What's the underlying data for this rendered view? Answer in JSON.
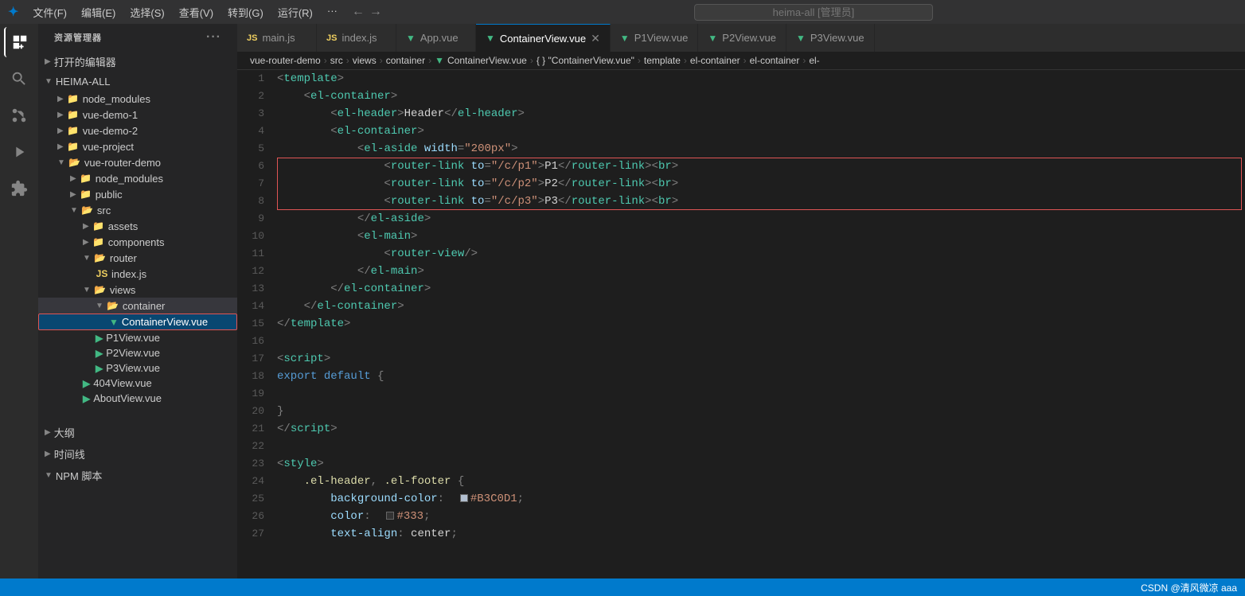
{
  "titlebar": {
    "logo": "VS",
    "menus": [
      "文件(F)",
      "编辑(E)",
      "选择(S)",
      "查看(V)",
      "转到(G)",
      "运行(R)",
      "···"
    ],
    "search_placeholder": "heima-all [管理员]",
    "back_arrow": "←",
    "forward_arrow": "→"
  },
  "sidebar": {
    "header": "资源管理器",
    "dots": "···",
    "open_editors_label": "打开的编辑器",
    "root": "HEIMA-ALL",
    "items": [
      {
        "label": "node_modules",
        "indent": 1,
        "type": "folder",
        "collapsed": true
      },
      {
        "label": "vue-demo-1",
        "indent": 1,
        "type": "folder",
        "collapsed": true
      },
      {
        "label": "vue-demo-2",
        "indent": 1,
        "type": "folder",
        "collapsed": true
      },
      {
        "label": "vue-project",
        "indent": 1,
        "type": "folder",
        "collapsed": true
      },
      {
        "label": "vue-router-demo",
        "indent": 1,
        "type": "folder",
        "collapsed": false
      },
      {
        "label": "node_modules",
        "indent": 2,
        "type": "folder",
        "collapsed": true
      },
      {
        "label": "public",
        "indent": 2,
        "type": "folder",
        "collapsed": true
      },
      {
        "label": "src",
        "indent": 2,
        "type": "folder",
        "collapsed": false
      },
      {
        "label": "assets",
        "indent": 3,
        "type": "folder-img",
        "collapsed": true
      },
      {
        "label": "components",
        "indent": 3,
        "type": "folder-img",
        "collapsed": true
      },
      {
        "label": "router",
        "indent": 3,
        "type": "folder",
        "collapsed": false
      },
      {
        "label": "index.js",
        "indent": 4,
        "type": "js"
      },
      {
        "label": "views",
        "indent": 3,
        "type": "folder",
        "collapsed": false
      },
      {
        "label": "container",
        "indent": 4,
        "type": "folder",
        "collapsed": false,
        "selected": true
      },
      {
        "label": "ContainerView.vue",
        "indent": 5,
        "type": "vue",
        "active": true
      },
      {
        "label": "P1View.vue",
        "indent": 4,
        "type": "vue"
      },
      {
        "label": "P2View.vue",
        "indent": 4,
        "type": "vue"
      },
      {
        "label": "P3View.vue",
        "indent": 4,
        "type": "vue"
      },
      {
        "label": "404View.vue",
        "indent": 3,
        "type": "vue"
      },
      {
        "label": "AboutView.vue",
        "indent": 3,
        "type": "vue"
      }
    ],
    "bottom_sections": [
      {
        "label": "大纲",
        "collapsed": true
      },
      {
        "label": "时间线",
        "collapsed": true
      },
      {
        "label": "NPM 脚本",
        "collapsed": false
      }
    ]
  },
  "tabs": [
    {
      "label": "main.js",
      "type": "js",
      "active": false
    },
    {
      "label": "index.js",
      "type": "js",
      "active": false
    },
    {
      "label": "App.vue",
      "type": "vue",
      "active": false
    },
    {
      "label": "ContainerView.vue",
      "type": "vue",
      "active": true,
      "closeable": true
    },
    {
      "label": "P1View.vue",
      "type": "vue",
      "active": false
    },
    {
      "label": "P2View.vue",
      "type": "vue",
      "active": false
    },
    {
      "label": "P3View.vue",
      "type": "vue",
      "active": false
    }
  ],
  "breadcrumb": {
    "parts": [
      "vue-router-demo",
      "src",
      "views",
      "container",
      "ContainerView.vue",
      "{ } \"ContainerView.vue\"",
      "template",
      "el-container",
      "el-container",
      "el-"
    ]
  },
  "code": {
    "lines": [
      {
        "num": 1,
        "content": "template_open"
      },
      {
        "num": 2,
        "content": "el_container_open"
      },
      {
        "num": 3,
        "content": "el_header"
      },
      {
        "num": 4,
        "content": "el_container_open2"
      },
      {
        "num": 5,
        "content": "el_aside"
      },
      {
        "num": 6,
        "content": "router_link_p1",
        "highlighted": true
      },
      {
        "num": 7,
        "content": "router_link_p2",
        "highlighted": true
      },
      {
        "num": 8,
        "content": "router_link_p3",
        "highlighted": true
      },
      {
        "num": 9,
        "content": "el_aside_close"
      },
      {
        "num": 10,
        "content": "el_main_open"
      },
      {
        "num": 11,
        "content": "router_view"
      },
      {
        "num": 12,
        "content": "el_main_close"
      },
      {
        "num": 13,
        "content": "el_container_close"
      },
      {
        "num": 14,
        "content": "el_container_close2"
      },
      {
        "num": 15,
        "content": "template_close"
      },
      {
        "num": 16,
        "content": "empty"
      },
      {
        "num": 17,
        "content": "script_open"
      },
      {
        "num": 18,
        "content": "export_default"
      },
      {
        "num": 19,
        "content": "empty"
      },
      {
        "num": 20,
        "content": "close_brace"
      },
      {
        "num": 21,
        "content": "script_close"
      },
      {
        "num": 22,
        "content": "empty"
      },
      {
        "num": 23,
        "content": "style_open"
      },
      {
        "num": 24,
        "content": "style_rule1"
      },
      {
        "num": 25,
        "content": "style_prop1"
      },
      {
        "num": 26,
        "content": "style_prop2"
      },
      {
        "num": 27,
        "content": "style_prop3"
      }
    ]
  },
  "status_bar": {
    "right_text": "CSDN @清风微凉 aaa"
  }
}
